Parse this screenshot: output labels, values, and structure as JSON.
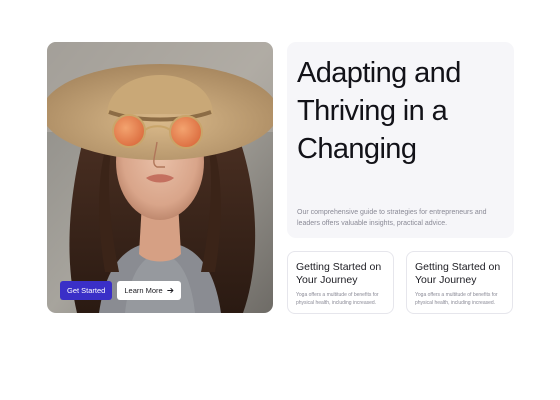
{
  "hero": {
    "image_alt": "Woman wearing a straw hat and round orange sunglasses",
    "primary_button": "Get Started",
    "secondary_button": "Learn More",
    "secondary_icon": "arrow-right-icon"
  },
  "headline": {
    "title": "Adapting and Thriving in a Changing",
    "description": "Our comprehensive guide to strategies for entrepreneurs and leaders offers valuable insights, practical advice."
  },
  "cards": [
    {
      "title": "Getting Started on Your Journey",
      "body": "Yoga offers a multitude of benefits for physical health, including increased."
    },
    {
      "title": "Getting Started on Your Journey",
      "body": "Yoga offers a multitude of benefits for physical health, including increased."
    }
  ],
  "colors": {
    "primary": "#3a2fc7",
    "panel_bg": "#f6f6f9",
    "muted_text": "#8a8a96"
  }
}
